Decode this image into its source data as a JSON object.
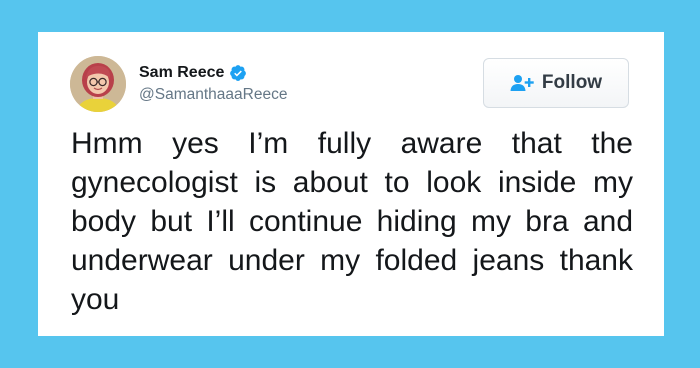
{
  "tweet": {
    "author": {
      "display_name": "Sam Reece",
      "handle": "@SamanthaaaReece",
      "verified": true,
      "avatar_icon": "avatar-photo"
    },
    "follow_button": {
      "label": "Follow",
      "icon": "add-user-icon"
    },
    "text": "Hmm yes I’m fully aware that the gynecologist is about to look inside my body but I’ll continue hiding my bra and underwear under my folded jeans thank you"
  },
  "colors": {
    "background": "#56c5ee",
    "card": "#ffffff",
    "verified_badge": "#1da1f2",
    "follow_icon": "#1da1f2",
    "name_text": "#14171a",
    "handle_text": "#657786"
  }
}
